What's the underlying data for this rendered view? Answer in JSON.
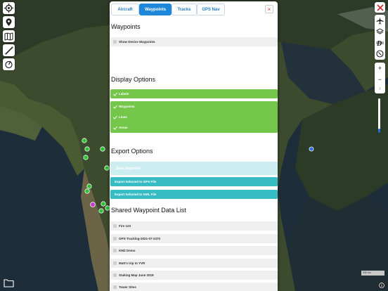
{
  "tabs": [
    {
      "label": "Aircraft",
      "active": false
    },
    {
      "label": "Waypoints",
      "active": true
    },
    {
      "label": "Tracks",
      "active": false
    },
    {
      "label": "GPS Nav",
      "active": false
    }
  ],
  "close_label": "×",
  "sections": {
    "waypoints": {
      "title": "Waypoints",
      "show_device_label": "Show Device Waypoints"
    },
    "display": {
      "title": "Display Options",
      "labels": "Labels",
      "waypoints": "Waypoints",
      "lines": "Lines",
      "areas": "Areas"
    },
    "export": {
      "title": "Export Options",
      "save_imported": "Save Imported",
      "export_gpx": "Export Selected to GPX File",
      "export_kml": "Export Selected to KML File"
    },
    "shared": {
      "title": "Shared Waypoint Data List",
      "items": [
        "Fire 123",
        "GPS-Tracklog-2021-07-2370",
        "KMZ Demo",
        "Matt's trip to YVR",
        "Staking Map June 2019",
        "Tower Sites"
      ]
    }
  },
  "map": {
    "zoom_in": "+",
    "zoom_out": "−",
    "north": "↑",
    "scale_label": "300 nm"
  },
  "colors": {
    "tab_active": "#1f87d9",
    "green": "#74c74a",
    "teal": "#38bcc4",
    "marker_green": "#27c22d",
    "marker_magenta": "#c03ad0",
    "marker_blue": "#2a6de0"
  }
}
